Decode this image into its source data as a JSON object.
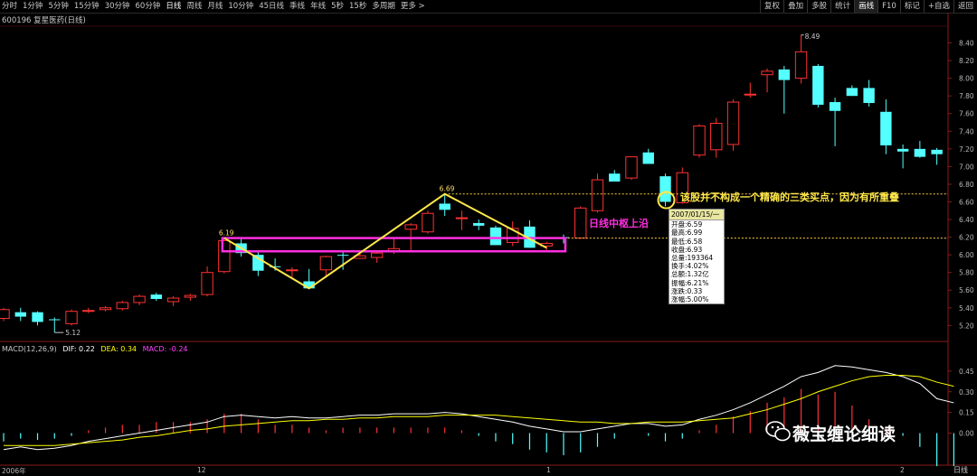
{
  "toolbar": {
    "periods": [
      {
        "label": "分时",
        "active": false
      },
      {
        "label": "1分钟",
        "active": false
      },
      {
        "label": "5分钟",
        "active": false
      },
      {
        "label": "15分钟",
        "active": false
      },
      {
        "label": "30分钟",
        "active": false
      },
      {
        "label": "60分钟",
        "active": false
      },
      {
        "label": "日线",
        "active": true
      },
      {
        "label": "周线",
        "active": false
      },
      {
        "label": "月线",
        "active": false
      },
      {
        "label": "10分钟",
        "active": false
      },
      {
        "label": "45日线",
        "active": false
      },
      {
        "label": "季线",
        "active": false
      },
      {
        "label": "年线",
        "active": false
      },
      {
        "label": "5秒",
        "active": false
      },
      {
        "label": "15秒",
        "active": false
      },
      {
        "label": "多周期",
        "active": false
      },
      {
        "label": "更多 >",
        "active": false
      }
    ],
    "tools": [
      {
        "label": "复权",
        "active": false
      },
      {
        "label": "叠加",
        "active": false
      },
      {
        "label": "多股",
        "active": false
      },
      {
        "label": "统计",
        "active": false
      },
      {
        "label": "画线",
        "active": true
      },
      {
        "label": "F10",
        "active": false
      },
      {
        "label": "标记",
        "active": false
      },
      {
        "label": "+自选",
        "active": false
      },
      {
        "label": "返回",
        "active": false
      }
    ]
  },
  "stock_title": "600196 复星医药(日线)",
  "macd_legend": {
    "name": "MACD(12,26,9)",
    "dif": "DIF: 0.22",
    "dea": "DEA: 0.34",
    "macd": "MACD: -0.24"
  },
  "colors": {
    "up": "#ff3232",
    "down": "#54ffff",
    "dif": "#ffffff",
    "dea": "#ffff00",
    "annotation": "#ffe84a",
    "zhongshu": "#ff2fe0"
  },
  "price_ticks": [
    "8.40",
    "8.20",
    "8.00",
    "7.80",
    "7.60",
    "7.40",
    "7.20",
    "7.00",
    "6.80",
    "6.60",
    "6.40",
    "6.20",
    "6.00",
    "5.80",
    "5.60",
    "5.40",
    "5.20"
  ],
  "macd_ticks": [
    "0.45",
    "0.30",
    "0.15",
    "0.00"
  ],
  "date_labels": [
    "2006年",
    "12",
    "1",
    "2"
  ],
  "period_label": "日线",
  "price_annotations": {
    "high": "8.49",
    "low": "5.12",
    "peak": "6.69",
    "zs_top": "6.19"
  },
  "tooltip": {
    "date": "2007/01/15/一",
    "rows": [
      "开盘:6.59",
      "最高:6.99",
      "最低:6.58",
      "收盘:6.93",
      "总量:193364",
      "换手:4.02%",
      "总额:1.32亿",
      "振幅:6.21%",
      "涨跌:0.33",
      "涨幅:5.00%"
    ]
  },
  "annotation_text": "该股并不构成一个精确的三类买点，因为有所重叠",
  "zhongshu_label": "日线中枢上沿",
  "watermark": "薇宝缠论细读",
  "chart_data": {
    "type": "candlestick",
    "ylim": [
      5.05,
      8.6
    ],
    "candles": [
      {
        "o": 5.28,
        "h": 5.4,
        "l": 5.25,
        "c": 5.38
      },
      {
        "o": 5.35,
        "h": 5.4,
        "l": 5.25,
        "c": 5.3
      },
      {
        "o": 5.35,
        "h": 5.36,
        "l": 5.2,
        "c": 5.24
      },
      {
        "o": 5.27,
        "h": 5.29,
        "l": 5.12,
        "c": 5.26
      },
      {
        "o": 5.22,
        "h": 5.38,
        "l": 5.2,
        "c": 5.36
      },
      {
        "o": 5.36,
        "h": 5.4,
        "l": 5.34,
        "c": 5.37
      },
      {
        "o": 5.38,
        "h": 5.42,
        "l": 5.36,
        "c": 5.4
      },
      {
        "o": 5.39,
        "h": 5.48,
        "l": 5.37,
        "c": 5.46
      },
      {
        "o": 5.46,
        "h": 5.55,
        "l": 5.43,
        "c": 5.53
      },
      {
        "o": 5.55,
        "h": 5.57,
        "l": 5.48,
        "c": 5.5
      },
      {
        "o": 5.47,
        "h": 5.53,
        "l": 5.42,
        "c": 5.51
      },
      {
        "o": 5.52,
        "h": 5.56,
        "l": 5.48,
        "c": 5.54
      },
      {
        "o": 5.55,
        "h": 5.87,
        "l": 5.53,
        "c": 5.8
      },
      {
        "o": 5.81,
        "h": 6.19,
        "l": 5.79,
        "c": 6.16
      },
      {
        "o": 6.13,
        "h": 6.19,
        "l": 5.98,
        "c": 6.02
      },
      {
        "o": 6.0,
        "h": 6.03,
        "l": 5.76,
        "c": 5.82
      },
      {
        "o": 5.87,
        "h": 5.96,
        "l": 5.82,
        "c": 5.86
      },
      {
        "o": 5.83,
        "h": 5.86,
        "l": 5.74,
        "c": 5.83
      },
      {
        "o": 5.7,
        "h": 5.84,
        "l": 5.62,
        "c": 5.62
      },
      {
        "o": 5.83,
        "h": 5.99,
        "l": 5.74,
        "c": 5.98
      },
      {
        "o": 6.0,
        "h": 6.04,
        "l": 5.83,
        "c": 5.99
      },
      {
        "o": 5.96,
        "h": 6.02,
        "l": 5.96,
        "c": 5.99
      },
      {
        "o": 5.97,
        "h": 6.05,
        "l": 5.91,
        "c": 6.02
      },
      {
        "o": 6.04,
        "h": 6.19,
        "l": 6.01,
        "c": 6.07
      },
      {
        "o": 6.29,
        "h": 6.36,
        "l": 6.05,
        "c": 6.34
      },
      {
        "o": 6.26,
        "h": 6.5,
        "l": 6.24,
        "c": 6.47
      },
      {
        "o": 6.58,
        "h": 6.69,
        "l": 6.44,
        "c": 6.51
      },
      {
        "o": 6.42,
        "h": 6.5,
        "l": 6.28,
        "c": 6.42
      },
      {
        "o": 6.36,
        "h": 6.4,
        "l": 6.28,
        "c": 6.33
      },
      {
        "o": 6.31,
        "h": 6.33,
        "l": 6.11,
        "c": 6.11
      },
      {
        "o": 6.14,
        "h": 6.38,
        "l": 6.1,
        "c": 6.3
      },
      {
        "o": 6.32,
        "h": 6.39,
        "l": 6.08,
        "c": 6.08
      },
      {
        "o": 6.1,
        "h": 6.15,
        "l": 6.05,
        "c": 6.13
      },
      {
        "o": 6.2,
        "h": 6.23,
        "l": 6.13,
        "c": 6.19
      },
      {
        "o": 6.19,
        "h": 6.55,
        "l": 6.18,
        "c": 6.53
      },
      {
        "o": 6.5,
        "h": 6.92,
        "l": 6.48,
        "c": 6.85
      },
      {
        "o": 6.92,
        "h": 6.96,
        "l": 6.86,
        "c": 6.83
      },
      {
        "o": 6.87,
        "h": 7.11,
        "l": 6.85,
        "c": 7.11
      },
      {
        "o": 7.16,
        "h": 7.2,
        "l": 7.03,
        "c": 7.03
      },
      {
        "o": 6.89,
        "h": 6.92,
        "l": 6.55,
        "c": 6.6
      },
      {
        "o": 6.59,
        "h": 6.99,
        "l": 6.58,
        "c": 6.93
      },
      {
        "o": 7.13,
        "h": 7.48,
        "l": 7.1,
        "c": 7.46
      },
      {
        "o": 7.19,
        "h": 7.55,
        "l": 7.1,
        "c": 7.49
      },
      {
        "o": 7.25,
        "h": 7.76,
        "l": 7.18,
        "c": 7.73
      },
      {
        "o": 7.81,
        "h": 7.95,
        "l": 7.78,
        "c": 7.82
      },
      {
        "o": 8.04,
        "h": 8.11,
        "l": 7.84,
        "c": 8.08
      },
      {
        "o": 8.1,
        "h": 8.14,
        "l": 7.6,
        "c": 7.98
      },
      {
        "o": 8.0,
        "h": 8.49,
        "l": 7.94,
        "c": 8.3
      },
      {
        "o": 8.14,
        "h": 8.16,
        "l": 7.67,
        "c": 7.7
      },
      {
        "o": 7.73,
        "h": 7.78,
        "l": 7.23,
        "c": 7.63
      },
      {
        "o": 7.89,
        "h": 7.92,
        "l": 7.8,
        "c": 7.8
      },
      {
        "o": 7.89,
        "h": 7.98,
        "l": 7.68,
        "c": 7.72
      },
      {
        "o": 7.62,
        "h": 7.76,
        "l": 7.14,
        "c": 7.24
      },
      {
        "o": 7.2,
        "h": 7.25,
        "l": 6.98,
        "c": 7.17
      },
      {
        "o": 7.2,
        "h": 7.29,
        "l": 7.1,
        "c": 7.11
      },
      {
        "o": 7.19,
        "h": 7.21,
        "l": 7.02,
        "c": 7.14
      }
    ],
    "macd": {
      "ylim": [
        -0.2,
        0.6
      ],
      "dif": [
        -0.12,
        -0.1,
        -0.12,
        -0.11,
        -0.09,
        -0.06,
        -0.04,
        -0.02,
        0.0,
        0.02,
        0.04,
        0.06,
        0.08,
        0.12,
        0.13,
        0.12,
        0.11,
        0.12,
        0.11,
        0.11,
        0.12,
        0.13,
        0.13,
        0.14,
        0.14,
        0.14,
        0.15,
        0.14,
        0.12,
        0.1,
        0.08,
        0.05,
        0.03,
        0.01,
        0.01,
        0.03,
        0.05,
        0.07,
        0.07,
        0.05,
        0.06,
        0.1,
        0.13,
        0.17,
        0.22,
        0.28,
        0.34,
        0.41,
        0.44,
        0.49,
        0.48,
        0.46,
        0.44,
        0.41,
        0.36,
        0.25,
        0.22
      ],
      "dea": [
        -0.09,
        -0.09,
        -0.09,
        -0.09,
        -0.08,
        -0.07,
        -0.06,
        -0.05,
        -0.03,
        -0.02,
        0.0,
        0.02,
        0.03,
        0.05,
        0.06,
        0.07,
        0.08,
        0.09,
        0.09,
        0.1,
        0.1,
        0.11,
        0.11,
        0.12,
        0.12,
        0.12,
        0.13,
        0.13,
        0.13,
        0.13,
        0.12,
        0.11,
        0.1,
        0.09,
        0.08,
        0.08,
        0.07,
        0.07,
        0.08,
        0.08,
        0.08,
        0.09,
        0.1,
        0.11,
        0.14,
        0.17,
        0.21,
        0.25,
        0.3,
        0.34,
        0.38,
        0.41,
        0.42,
        0.42,
        0.41,
        0.37,
        0.34
      ],
      "hist": [
        -0.06,
        -0.04,
        -0.05,
        -0.04,
        -0.02,
        0.02,
        0.04,
        0.06,
        0.06,
        0.08,
        0.08,
        0.08,
        0.1,
        0.14,
        0.14,
        0.1,
        0.06,
        0.06,
        0.04,
        0.02,
        0.04,
        0.04,
        0.04,
        0.04,
        0.04,
        0.04,
        0.04,
        0.02,
        -0.02,
        -0.06,
        -0.08,
        -0.12,
        -0.14,
        -0.16,
        -0.14,
        -0.1,
        -0.04,
        0.0,
        -0.02,
        -0.06,
        -0.04,
        0.02,
        0.06,
        0.12,
        0.16,
        0.22,
        0.26,
        0.32,
        0.28,
        0.3,
        0.2,
        0.1,
        0.04,
        -0.02,
        -0.1,
        -0.24,
        -0.24
      ]
    }
  }
}
